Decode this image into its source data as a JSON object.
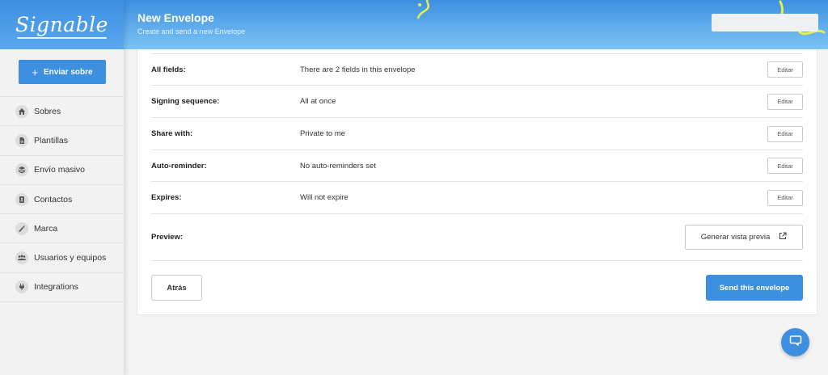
{
  "app": {
    "logo_text": "Signable"
  },
  "colors": {
    "accent": "#3d8fe0",
    "header_gradient_end": "#7cc4f5",
    "confetti": "#e6f04a"
  },
  "sidebar": {
    "send_button": {
      "icon": "plus-icon",
      "label": "Enviar sobre"
    },
    "items": [
      {
        "label": "Sobres",
        "icon": "home-icon"
      },
      {
        "label": "Plantillas",
        "icon": "document-icon"
      },
      {
        "label": "Envío masivo",
        "icon": "stack-icon"
      },
      {
        "label": "Contactos",
        "icon": "contact-card-icon"
      },
      {
        "label": "Marca",
        "icon": "brush-icon"
      },
      {
        "label": "Usuarios y equipos",
        "icon": "users-icon"
      },
      {
        "label": "Integrations",
        "icon": "plug-icon"
      }
    ]
  },
  "header": {
    "title": "New Envelope",
    "subtitle": "Create and send a new Envelope"
  },
  "details": {
    "rows": [
      {
        "label": "All fields:",
        "value": "There are 2 fields in this envelope",
        "action": "Editar"
      },
      {
        "label": "Signing sequence:",
        "value": "All at once",
        "action": "Editar"
      },
      {
        "label": "Share with:",
        "value": "Private to me",
        "action": "Editar"
      },
      {
        "label": "Auto-reminder:",
        "value": "No auto-reminders set",
        "action": "Editar"
      },
      {
        "label": "Expires:",
        "value": "Will not expire",
        "action": "Editar"
      }
    ],
    "preview": {
      "label": "Preview:",
      "button_label": "Generar vista previa",
      "button_icon": "external-link-icon"
    }
  },
  "footer": {
    "back_label": "Atrás",
    "submit_label": "Send this envelope"
  },
  "support": {
    "icon": "chat-bubble-icon"
  }
}
